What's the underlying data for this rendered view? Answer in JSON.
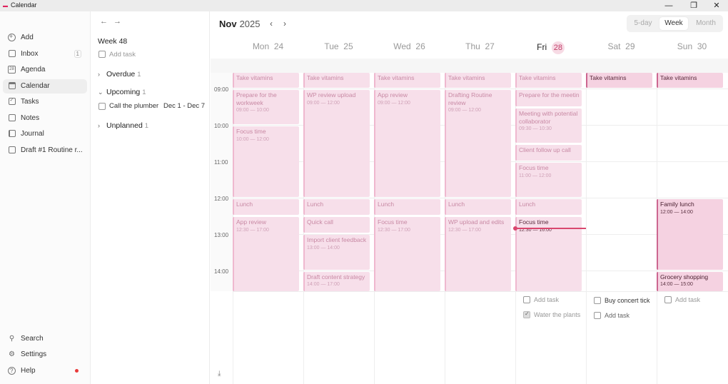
{
  "window": {
    "title": "Calendar",
    "minimize": "—",
    "restore": "❐",
    "close": "✕"
  },
  "sidebar": {
    "items": [
      {
        "label": "Add",
        "icon": "plus-circle-icon"
      },
      {
        "label": "Inbox",
        "icon": "inbox-icon",
        "count": "1"
      },
      {
        "label": "Agenda",
        "icon": "agenda-icon",
        "glyph": "28"
      },
      {
        "label": "Calendar",
        "icon": "calendar-icon"
      },
      {
        "label": "Tasks",
        "icon": "tasks-icon"
      },
      {
        "label": "Notes",
        "icon": "notes-icon"
      },
      {
        "label": "Journal",
        "icon": "journal-icon"
      },
      {
        "label": "Draft #1 Routine r...",
        "icon": "document-icon"
      }
    ],
    "bottom": [
      {
        "label": "Search",
        "icon": "search-icon"
      },
      {
        "label": "Settings",
        "icon": "gear-icon"
      },
      {
        "label": "Help",
        "icon": "help-icon"
      }
    ]
  },
  "taskpanel": {
    "week": "Week 48",
    "add_task": "Add task",
    "groups": {
      "overdue": {
        "label": "Overdue",
        "count": "1"
      },
      "upcoming": {
        "label": "Upcoming",
        "count": "1"
      },
      "unplanned": {
        "label": "Unplanned",
        "count": "1"
      }
    },
    "upcoming_task": {
      "title": "Call the plumber",
      "range": "Dec 1 - Dec 7"
    }
  },
  "header": {
    "month": "Nov",
    "year": "2025",
    "views": [
      "5-day",
      "Week",
      "Month"
    ],
    "selected_view": "Week"
  },
  "days": [
    {
      "name": "Mon",
      "num": "24"
    },
    {
      "name": "Tue",
      "num": "25"
    },
    {
      "name": "Wed",
      "num": "26"
    },
    {
      "name": "Thu",
      "num": "27"
    },
    {
      "name": "Fri",
      "num": "28",
      "today": true
    },
    {
      "name": "Sat",
      "num": "29"
    },
    {
      "name": "Sun",
      "num": "30"
    }
  ],
  "hours": [
    "09:00",
    "10:00",
    "11:00",
    "12:00",
    "13:00",
    "14:00"
  ],
  "events": {
    "mon": [
      {
        "title": "Take vitamins"
      },
      {
        "title": "Prepare for the workweek",
        "time": "09:00 — 10:00"
      },
      {
        "title": "Focus time",
        "time": "10:00 — 12:00"
      },
      {
        "title": "Lunch"
      },
      {
        "title": "App review",
        "time": "12:30 — 17:00"
      }
    ],
    "tue": [
      {
        "title": "Take vitamins"
      },
      {
        "title": "WP review upload",
        "time": "09:00 — 12:00"
      },
      {
        "title": "Lunch"
      },
      {
        "title": "Quick call"
      },
      {
        "title": "Import client feedback",
        "time": "13:00 — 14:00"
      },
      {
        "title": "Draft content strategy",
        "time": "14:00 — 17:00"
      }
    ],
    "wed": [
      {
        "title": "Take vitamins"
      },
      {
        "title": "App review",
        "time": "09:00 — 12:00"
      },
      {
        "title": "Lunch"
      },
      {
        "title": "Focus time",
        "time": "12:30 — 17:00"
      }
    ],
    "thu": [
      {
        "title": "Take vitamins"
      },
      {
        "title": "Drafting Routine review",
        "time": "09:00 — 12:00"
      },
      {
        "title": "Lunch"
      },
      {
        "title": "WP upload and edits",
        "time": "12:30 — 17:00"
      }
    ],
    "fri": [
      {
        "title": "Take vitamins"
      },
      {
        "title": "Prepare for the meetin"
      },
      {
        "title": "Meeting with potential collaborator",
        "time": "09:30 — 10:30"
      },
      {
        "title": "Client follow up call"
      },
      {
        "title": "Focus time",
        "time": "11:00 — 12:00"
      },
      {
        "title": "Lunch"
      },
      {
        "title": "Focus time",
        "time": "12:30 — 16:00"
      }
    ],
    "sat": [
      {
        "title": "Take vitamins"
      }
    ],
    "sun": [
      {
        "title": "Take vitamins"
      },
      {
        "title": "Family lunch",
        "time": "12:00 — 14:00"
      },
      {
        "title": "Grocery shopping",
        "time": "14:00 — 15:00"
      }
    ]
  },
  "trays": {
    "fri": [
      {
        "title": "Add task"
      },
      {
        "title": "Water the plants",
        "done": true
      }
    ],
    "sat": [
      {
        "title": "Buy concert tick"
      },
      {
        "title": "Add task"
      }
    ],
    "sun": [
      {
        "title": "Add task"
      }
    ]
  },
  "colors": {
    "accent": "#d9476e",
    "event_bg": "#f7dfea",
    "event_border": "#efb8cf"
  }
}
